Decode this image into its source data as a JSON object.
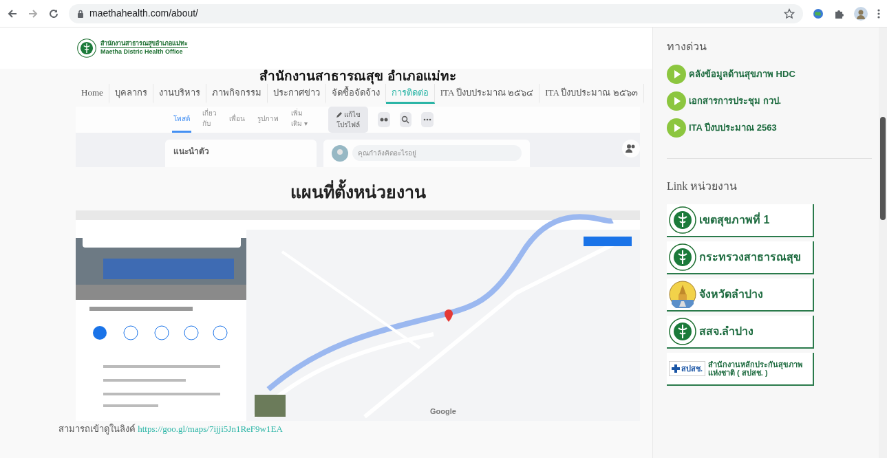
{
  "browser": {
    "url": "maethahealth.com/about/"
  },
  "header": {
    "logo_text_thai": "สำนักงานสาธารณสุขอำเภอแม่ทะ",
    "logo_text_english": "Maetha Distric Health Office"
  },
  "site_title": "สำนักงานสาธารณสุข อำเภอแม่ทะ",
  "nav": [
    {
      "label": "Home",
      "selected": false
    },
    {
      "label": "บุคลากร",
      "selected": false
    },
    {
      "label": "งานบริหาร",
      "selected": false
    },
    {
      "label": "ภาพกิจกรรม",
      "selected": false
    },
    {
      "label": "ประกาศข่าว",
      "selected": false
    },
    {
      "label": "จัดซื้อจัดจ้าง",
      "selected": false
    },
    {
      "label": "การติดต่อ",
      "selected": true
    },
    {
      "label": "ITA ปีงบประมาณ ๒๕๖๔",
      "selected": false
    },
    {
      "label": "ITA ปีงบประมาณ ๒๕๖๓",
      "selected": false
    }
  ],
  "facebook_embed": {
    "tabs": [
      {
        "label": "โพสต์",
        "selected": true
      },
      {
        "label": "เกี่ยวกับ",
        "selected": false
      },
      {
        "label": "เพื่อน",
        "selected": false
      },
      {
        "label": "รูปภาพ",
        "selected": false
      },
      {
        "label": "เพิ่มเติม ▾",
        "selected": false
      }
    ],
    "edit_button": "แก้ไขโปรไฟล์",
    "intro_heading": "แนะนำตัว",
    "post_placeholder": "คุณกำลังคิดอะไรอยู่"
  },
  "map_section": {
    "heading": "แผนที่ตั้งหน่วยงาน",
    "map_brand": "Google",
    "link_prefix": "สามารถเข้าดูในลิงค์",
    "link_url": "https://goo.gl/maps/7ijji5Jn1ReF9w1EA"
  },
  "sidebar": {
    "quick_links_title": "ทางด่วน",
    "quick_links": [
      "คลังข้อมูลด้านสุขภาพ HDC",
      "เอกสารการประชุม กวป.",
      "ITA ปีงบประมาณ 2563"
    ],
    "agency_links_title": "Link หน่วยงาน",
    "agency_links": [
      {
        "kind": "moph",
        "label": "เขตสุขภาพที่ 1"
      },
      {
        "kind": "moph",
        "label": "กระทรวงสาธารณสุข"
      },
      {
        "kind": "province",
        "label": "จังหวัดลำปาง"
      },
      {
        "kind": "moph",
        "label": "สสจ.ลำปาง"
      },
      {
        "kind": "nhso",
        "logo_text": "สปสช.",
        "label": "สำนักงานหลักประกันสุขภาพแห่งชาติ ( สปสช. )"
      }
    ]
  }
}
